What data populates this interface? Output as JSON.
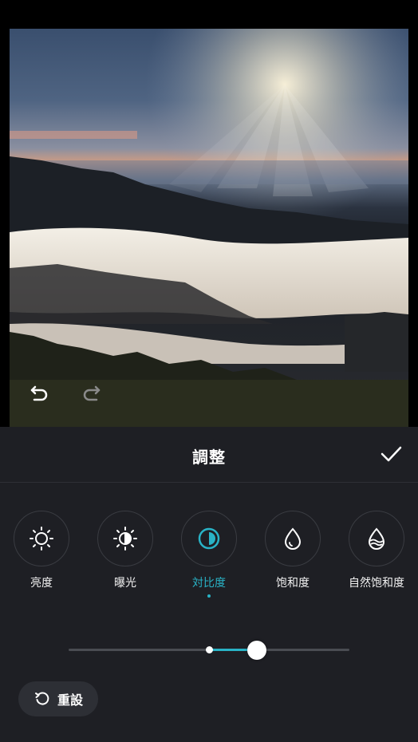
{
  "panel": {
    "title": "調整",
    "confirm_icon": "checkmark-icon"
  },
  "history": {
    "undo_icon": "undo-icon",
    "redo_icon": "redo-icon"
  },
  "tools": [
    {
      "label": "亮度",
      "icon": "brightness-icon",
      "active": false
    },
    {
      "label": "曝光",
      "icon": "exposure-icon",
      "active": false
    },
    {
      "label": "対比度",
      "icon": "contrast-icon",
      "active": true
    },
    {
      "label": "饱和度",
      "icon": "saturation-icon",
      "active": false
    },
    {
      "label": "自然饱和度",
      "icon": "vibrance-icon",
      "active": false
    }
  ],
  "slider": {
    "value_percent": 67,
    "center_percent": 50
  },
  "reset": {
    "label": "重設",
    "icon": "reset-icon"
  },
  "colors": {
    "accent": "#29b3c6",
    "panel_bg": "#1e1f24"
  }
}
